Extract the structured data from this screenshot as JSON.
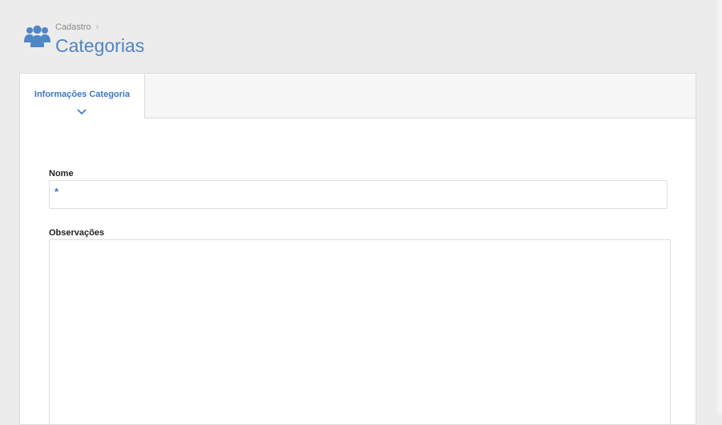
{
  "header": {
    "breadcrumb": "Cadastro",
    "breadcrumb_separator": "›",
    "title": "Categorias",
    "icon": "users-icon"
  },
  "tabs": [
    {
      "label": "Informações Categoria",
      "active": true,
      "icon": "chevron-down-icon"
    }
  ],
  "form": {
    "nome": {
      "label": "Nome",
      "value": "",
      "required_marker": "*"
    },
    "observacoes": {
      "label": "Observações",
      "value": ""
    }
  },
  "colors": {
    "accent": "#3a78c3",
    "title": "#4f86c6",
    "background": "#ececec"
  }
}
